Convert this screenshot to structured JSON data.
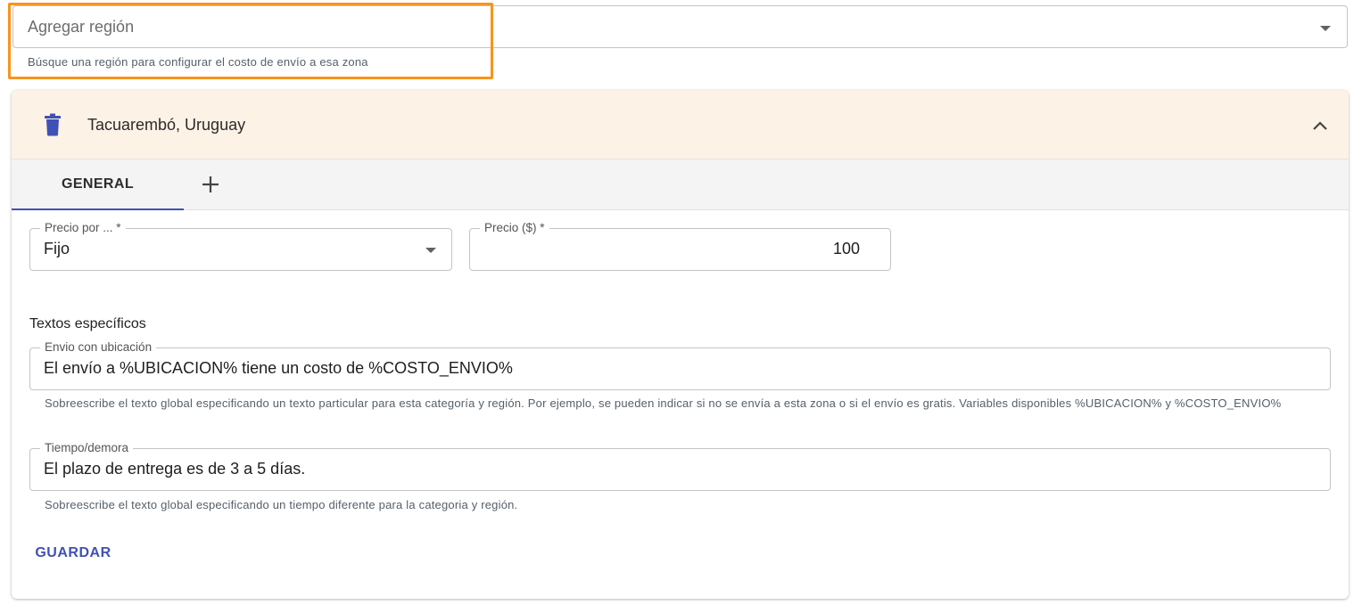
{
  "region_search": {
    "placeholder": "Agregar región",
    "hint": "Búsque una región para configurar el costo de envío a esa zona"
  },
  "region_panel": {
    "title": "Tacuarembó, Uruguay",
    "header_bg": "#fdf2e6",
    "tabs": [
      {
        "label": "GENERAL",
        "selected": true
      }
    ],
    "add_tab_icon": "plus-icon",
    "delete_icon": "trash-icon",
    "collapse_icon": "chevron-up-icon"
  },
  "form": {
    "precio_por": {
      "label": "Precio por ... *",
      "value": "Fijo"
    },
    "precio": {
      "label": "Precio ($) *",
      "value": "100"
    },
    "section_title": "Textos específicos",
    "envio": {
      "label": "Envio con ubicación",
      "value": "El envío a %UBICACION% tiene un costo de %COSTO_ENVIO%",
      "helper": "Sobreescribe el texto global especificando un texto particular para esta categoría y región. Por ejemplo, se pueden indicar si no se envía a esta zona o si el envío es gratis. Variables disponibles %UBICACION% y %COSTO_ENVIO%"
    },
    "tiempo": {
      "label": "Tiempo/demora",
      "value": "El plazo de entrega es de 3 a 5 días.",
      "helper": "Sobreescribe el texto global especificando un tiempo diferente para la categoria y región."
    },
    "save_label": "GUARDAR"
  },
  "colors": {
    "accent": "#3f51b5",
    "highlight": "#f7941d"
  }
}
